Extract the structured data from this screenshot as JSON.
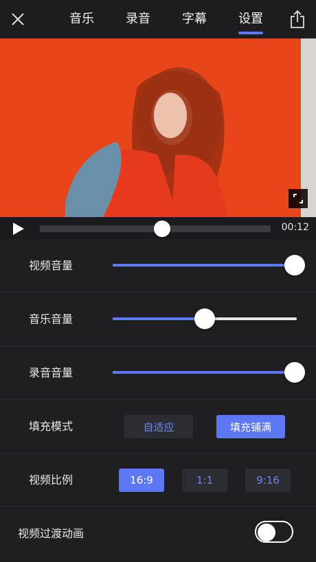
{
  "header": {
    "tabs": [
      {
        "label": "音乐"
      },
      {
        "label": "录音"
      },
      {
        "label": "字幕"
      },
      {
        "label": "设置"
      }
    ],
    "active_tab_index": 3
  },
  "player": {
    "time": "00:12",
    "progress_fraction": 0.53
  },
  "settings": {
    "video_volume": {
      "label": "视频音量",
      "level": 0.99
    },
    "music_volume": {
      "label": "音乐音量",
      "level": 0.5
    },
    "record_volume": {
      "label": "录音音量",
      "level": 0.99
    },
    "fill_mode": {
      "label": "填充模式",
      "options": [
        "自适应",
        "填充铺满"
      ],
      "selected_index": 1
    },
    "aspect_ratio": {
      "label": "视频比例",
      "options": [
        "16:9",
        "1:1",
        "9:16"
      ],
      "selected_index": 0
    },
    "transition": {
      "label": "视频过渡动画",
      "enabled": false
    }
  },
  "colors": {
    "accent": "#5d78f5",
    "background": "#1d1d21",
    "video_background": "#e64a19"
  },
  "icons": {
    "close": "close-icon",
    "share": "share-icon",
    "play": "play-icon",
    "fullscreen": "fullscreen-icon"
  }
}
